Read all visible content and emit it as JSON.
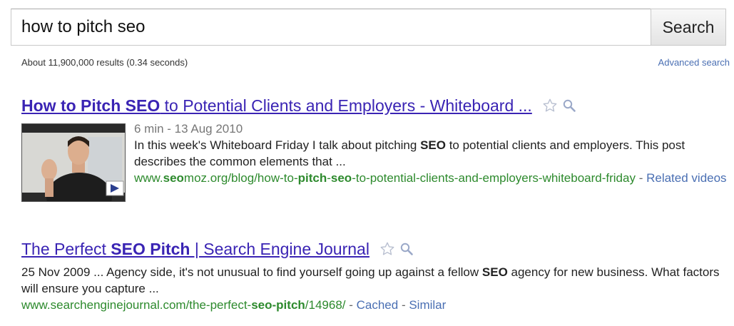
{
  "search": {
    "query": "how to pitch seo",
    "button_label": "Search"
  },
  "stats": {
    "text": "About 11,900,000 results (0.34 seconds)",
    "advanced_link": "Advanced search"
  },
  "results": [
    {
      "title_bold": "How to Pitch SEO",
      "title_rest": " to Potential Clients and Employers - Whiteboard ...",
      "meta": "6 min - 13 Aug 2010",
      "snippet_1": "In this week's Whiteboard Friday I talk about pitching ",
      "snippet_bold": "SEO",
      "snippet_2": " to potential clients and employers. This post describes the common elements that ...",
      "url_parts": [
        "www.",
        "seo",
        "moz.org/blog/how-to-",
        "pitch",
        "-",
        "seo",
        "-to-potential-clients-and-employers-whiteboard-friday"
      ],
      "sep": " - ",
      "link_1": "Related videos"
    },
    {
      "title_a": "The Perfect ",
      "title_bold": "SEO Pitch",
      "title_b": " | Search Engine Journal",
      "snippet_1": "25 Nov 2009 ... Agency side, it's not unusual to find yourself going up against a fellow ",
      "snippet_bold": "SEO",
      "snippet_2": " agency for new business. What factors will ensure you capture ...",
      "url_parts": [
        "www.searchenginejournal.com/the-perfect-",
        "seo-pitch",
        "/14968/"
      ],
      "sep": " - ",
      "link_1": "Cached",
      "link_2": "Similar"
    }
  ],
  "icons": {
    "star": "star-outline-icon",
    "magnifier": "magnifier-icon",
    "play": "play-icon"
  },
  "colors": {
    "title_link": "#3a24b4",
    "url_green": "#2d8a2d",
    "action_link": "#4a6fb3"
  }
}
